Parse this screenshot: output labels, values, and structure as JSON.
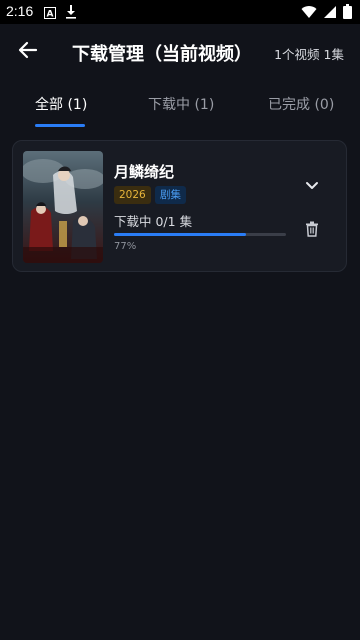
{
  "status_bar": {
    "time": "2:16",
    "left_icons": [
      "a-icon",
      "download-icon"
    ],
    "right_icons": [
      "wifi-icon",
      "signal-icon",
      "battery-icon"
    ]
  },
  "header": {
    "title": "下载管理（当前视频）",
    "summary": "1个视频 1集",
    "back_icon": "arrow-left-icon"
  },
  "tabs": [
    {
      "label": "全部 (1)",
      "active": true
    },
    {
      "label": "下载中 (1)",
      "active": false
    },
    {
      "label": "已完成 (0)",
      "active": false
    }
  ],
  "downloads": [
    {
      "title": "月鳞绮纪",
      "year_tag": "2026",
      "type_tag": "剧集",
      "status_text": "下载中 0/1 集",
      "progress_percent_text": "77%",
      "progress": 0.77
    }
  ],
  "colors": {
    "background": "#11131a",
    "card": "#181b23",
    "accent": "#2a7df6",
    "year_tag_text": "#e8b53a",
    "type_tag_text": "#4a9bf0"
  }
}
